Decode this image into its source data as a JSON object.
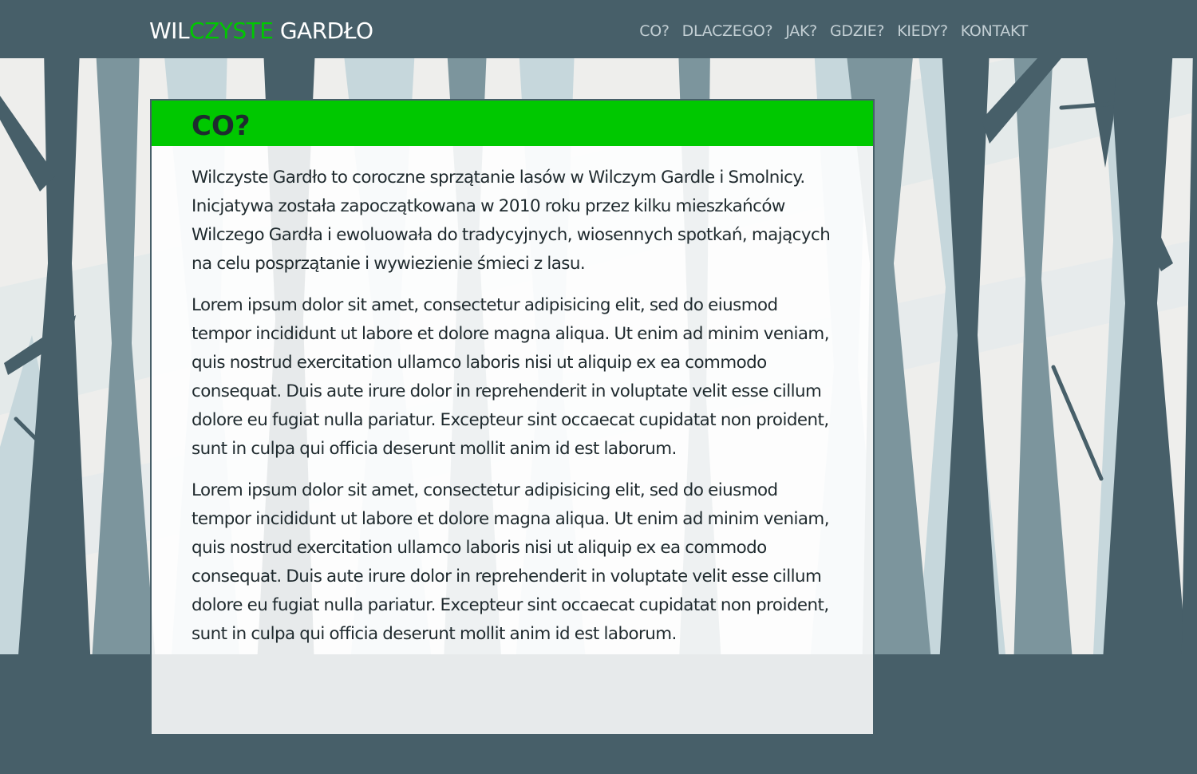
{
  "brand": {
    "part1": "WIL",
    "part2": "CZYSTE",
    "part3": " GARDŁO"
  },
  "nav": {
    "items": [
      {
        "label": "CO?"
      },
      {
        "label": "DLACZEGO?"
      },
      {
        "label": "JAK?"
      },
      {
        "label": "GDZIE?"
      },
      {
        "label": "KIEDY?"
      },
      {
        "label": "KONTAKT"
      }
    ]
  },
  "section": {
    "title": "CO?",
    "paragraphs": [
      "Wilczyste Gardło to coroczne sprzątanie lasów w Wilczym Gardle i Smolnicy. Inicjatywa została zapoczątkowana w 2010 roku przez kilku mieszkańców Wilczego Gardła i ewoluowała do tradycyjnych, wiosennych spotkań, mających na celu posprzątanie i wywiezienie śmieci z lasu.",
      "Lorem ipsum dolor sit amet, consectetur adipisicing elit, sed do eiusmod tempor incididunt ut labore et dolore magna aliqua. Ut enim ad minim veniam, quis nostrud exercitation ullamco laboris nisi ut aliquip ex ea commodo consequat. Duis aute irure dolor in reprehenderit in voluptate velit esse cillum dolore eu fugiat nulla pariatur. Excepteur sint occaecat cupidatat non proident, sunt in culpa qui officia deserunt mollit anim id est laborum.",
      "Lorem ipsum dolor sit amet, consectetur adipisicing elit, sed do eiusmod tempor incididunt ut labore et dolore magna aliqua. Ut enim ad minim veniam, quis nostrud exercitation ullamco laboris nisi ut aliquip ex ea commodo consequat. Duis aute irure dolor in reprehenderit in voluptate velit esse cillum dolore eu fugiat nulla pariatur. Excepteur sint occaecat cupidatat non proident, sunt in culpa qui officia deserunt mollit anim id est laborum."
    ]
  },
  "colors": {
    "navbar_bg": "#475f69",
    "accent": "#00c800",
    "nav_link": "#c3cfd4",
    "text": "#1f2a2e"
  }
}
